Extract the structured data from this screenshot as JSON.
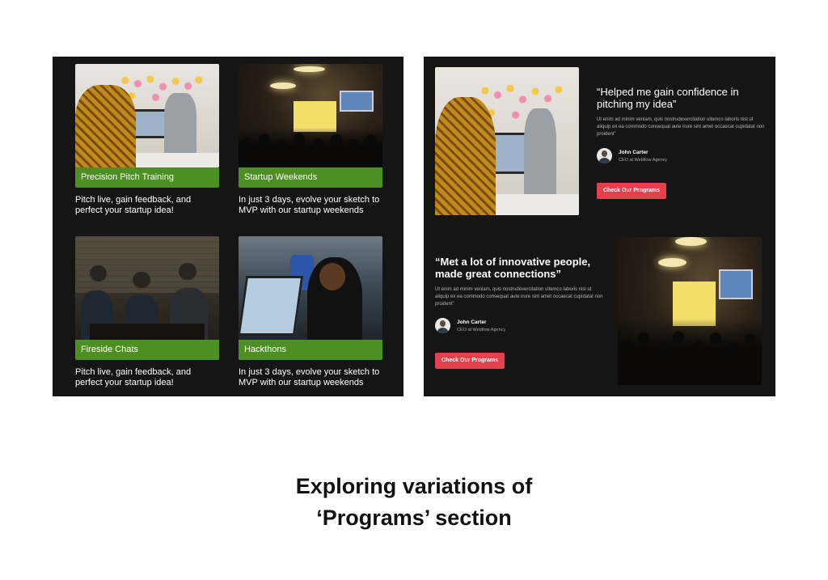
{
  "left": {
    "cards": [
      {
        "title": "Precision Pitch Training",
        "desc": "Pitch live, gain feedback, and perfect your startup idea!"
      },
      {
        "title": "Startup Weekends",
        "desc": "In just 3 days, evolve your sketch to MVP with our startup weekends"
      },
      {
        "title": "Fireside Chats",
        "desc": "Pitch live, gain feedback, and perfect your startup idea!"
      },
      {
        "title": "Hackthons",
        "desc": "In just 3 days, evolve your sketch to MVP with our startup weekends"
      }
    ]
  },
  "right": {
    "testimonials": [
      {
        "quote": "“Helped me gain confidence in pitching my idea”",
        "body": "Ut enim ad minim veniam, quis nostrudexercitation ullamco laboris nisi ut aliquip ex ea commodo consequat aute irure sint amet occaecat cupidatat non proident”",
        "name": "John Carter",
        "role": "CEO at Webflow Agency",
        "cta": "Check Our Programs"
      },
      {
        "quote": "“Met a lot of innovative people, made great connections”",
        "body": "Ut enim ad minim veniam, quis nostrudexercitation ullamco laboris nisi ut aliquip ex ea commodo consequat aute irure sint amet occaecat cupidatat non proident”",
        "name": "John Carter",
        "role": "CEO at Webflow Agency",
        "cta": "Check Our Programs"
      }
    ]
  },
  "caption": {
    "line1": "Exploring variations of",
    "line2": "‘Programs’ section"
  },
  "colors": {
    "panel_bg": "#151515",
    "label_green": "#4e8f24",
    "cta_red": "#e5404b"
  }
}
